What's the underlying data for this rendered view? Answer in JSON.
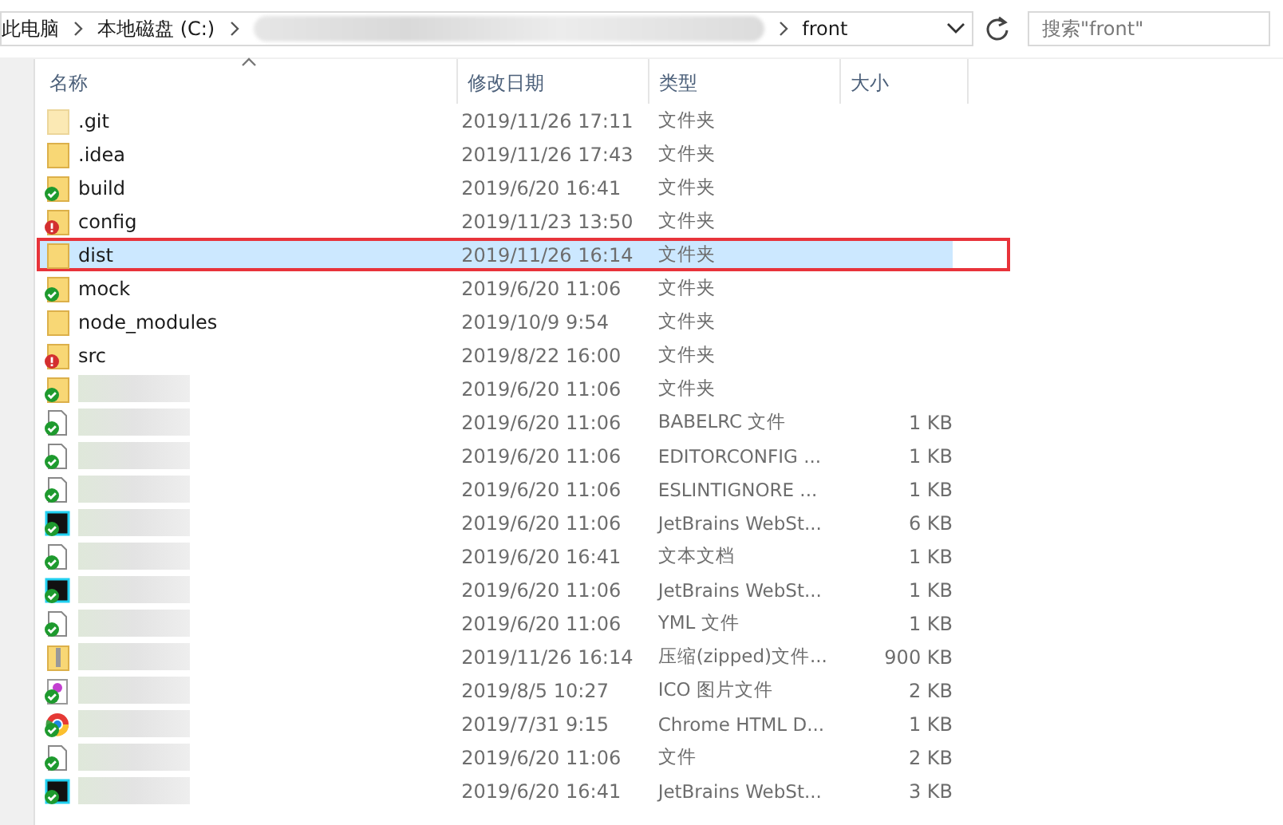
{
  "address_bar": {
    "segments": [
      {
        "label": "此电脑",
        "redacted": false
      },
      {
        "label": "本地磁盘 (C:)",
        "redacted": false
      },
      {
        "redacted": true
      },
      {
        "label": "front",
        "redacted": false
      }
    ]
  },
  "search": {
    "placeholder": "搜索\"front\""
  },
  "columns": [
    {
      "label": "名称",
      "sorted": true
    },
    {
      "label": "修改日期",
      "sorted": false
    },
    {
      "label": "类型",
      "sorted": false
    },
    {
      "label": "大小",
      "sorted": false
    }
  ],
  "rows": [
    {
      "kind": "folder",
      "hidden": true,
      "synced": false,
      "conflict": false,
      "redacted": false,
      "name": ".git",
      "date": "2019/11/26 17:11",
      "type": "文件夹",
      "selected": false,
      "annotated": false
    },
    {
      "kind": "folder",
      "hidden": false,
      "synced": false,
      "conflict": false,
      "redacted": false,
      "name": ".idea",
      "date": "2019/11/26 17:43",
      "type": "文件夹",
      "selected": false,
      "annotated": false
    },
    {
      "kind": "folder",
      "hidden": false,
      "synced": true,
      "conflict": false,
      "redacted": false,
      "name": "build",
      "date": "2019/6/20 16:41",
      "type": "文件夹",
      "selected": false,
      "annotated": false
    },
    {
      "kind": "folder",
      "hidden": false,
      "synced": false,
      "conflict": true,
      "redacted": false,
      "name": "config",
      "date": "2019/11/23 13:50",
      "type": "文件夹",
      "selected": false,
      "annotated": false
    },
    {
      "kind": "folder",
      "hidden": false,
      "synced": false,
      "conflict": false,
      "redacted": false,
      "name": "dist",
      "date": "2019/11/26 16:14",
      "type": "文件夹",
      "selected": true,
      "annotated": true
    },
    {
      "kind": "folder",
      "hidden": false,
      "synced": true,
      "conflict": false,
      "redacted": false,
      "name": "mock",
      "date": "2019/6/20 11:06",
      "type": "文件夹",
      "selected": false,
      "annotated": false
    },
    {
      "kind": "folder",
      "hidden": false,
      "synced": false,
      "conflict": false,
      "redacted": false,
      "name": "node_modules",
      "date": "2019/10/9 9:54",
      "type": "文件夹",
      "selected": false,
      "annotated": false
    },
    {
      "kind": "folder",
      "hidden": false,
      "synced": false,
      "conflict": true,
      "redacted": false,
      "name": "src",
      "date": "2019/8/22 16:00",
      "type": "文件夹",
      "selected": false,
      "annotated": false
    },
    {
      "kind": "folder",
      "hidden": false,
      "synced": true,
      "conflict": false,
      "redacted": true,
      "date": "2019/6/20 11:06",
      "type": "文件夹",
      "selected": false,
      "annotated": false
    },
    {
      "kind": "file",
      "synced": true,
      "conflict": false,
      "redacted": true,
      "date": "2019/6/20 11:06",
      "type": "BABELRC 文件",
      "size": "1 KB",
      "selected": false,
      "annotated": false
    },
    {
      "kind": "file",
      "synced": true,
      "conflict": false,
      "redacted": true,
      "date": "2019/6/20 11:06",
      "type": "EDITORCONFIG ...",
      "size": "1 KB",
      "selected": false,
      "annotated": false
    },
    {
      "kind": "file",
      "synced": true,
      "conflict": false,
      "redacted": true,
      "date": "2019/6/20 11:06",
      "type": "ESLINTIGNORE ...",
      "size": "1 KB",
      "selected": false,
      "annotated": false
    },
    {
      "kind": "ide-file",
      "synced": true,
      "conflict": false,
      "redacted": true,
      "date": "2019/6/20 11:06",
      "type": "JetBrains WebSt...",
      "size": "6 KB",
      "selected": false,
      "annotated": false
    },
    {
      "kind": "file",
      "synced": true,
      "conflict": false,
      "redacted": true,
      "date": "2019/6/20 16:41",
      "type": "文本文档",
      "size": "1 KB",
      "selected": false,
      "annotated": false
    },
    {
      "kind": "ide-file",
      "synced": true,
      "conflict": false,
      "redacted": true,
      "date": "2019/6/20 11:06",
      "type": "JetBrains WebSt...",
      "size": "1 KB",
      "selected": false,
      "annotated": false
    },
    {
      "kind": "file",
      "synced": true,
      "conflict": false,
      "redacted": true,
      "date": "2019/6/20 11:06",
      "type": "YML 文件",
      "size": "1 KB",
      "selected": false,
      "annotated": false
    },
    {
      "kind": "zip",
      "synced": false,
      "conflict": false,
      "redacted": true,
      "date": "2019/11/26 16:14",
      "type": "压缩(zipped)文件...",
      "size": "900 KB",
      "selected": false,
      "annotated": false
    },
    {
      "kind": "image-file",
      "synced": true,
      "conflict": false,
      "redacted": true,
      "date": "2019/8/5 10:27",
      "type": "ICO 图片文件",
      "size": "2 KB",
      "selected": false,
      "annotated": false
    },
    {
      "kind": "browser-file",
      "synced": true,
      "conflict": false,
      "redacted": true,
      "date": "2019/7/31 9:15",
      "type": "Chrome HTML D...",
      "size": "1 KB",
      "selected": false,
      "annotated": false
    },
    {
      "kind": "file",
      "synced": true,
      "conflict": false,
      "redacted": true,
      "date": "2019/6/20 11:06",
      "type": "文件",
      "size": "2 KB",
      "selected": false,
      "annotated": false
    },
    {
      "kind": "ide-file",
      "synced": true,
      "conflict": false,
      "redacted": true,
      "date": "2019/6/20 16:41",
      "type": "JetBrains WebSt...",
      "size": "3 KB",
      "selected": false,
      "annotated": false
    }
  ]
}
